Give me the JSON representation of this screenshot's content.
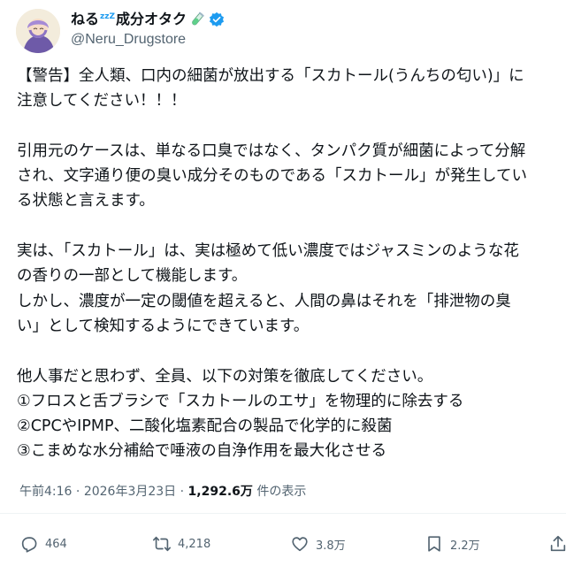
{
  "author": {
    "display_name_pre": "ねる",
    "display_name_zzz": "zzZ",
    "display_name_post": "成分オタク",
    "handle": "@Neru_Drugstore",
    "accent_color": "#1d9bf0"
  },
  "tweet": {
    "lines": [
      "【警告】全人類、口内の細菌が放出する「スカトール(うんちの匂い)」に",
      "注意してください！！！",
      "",
      "引用元のケースは、単なる口臭ではなく、タンパク質が細菌によって分解",
      "され、文字通り便の臭い成分そのものである「スカトール」が発生してい",
      "る状態と言えます。",
      "",
      "実は、「スカトール」は、実は極めて低い濃度ではジャスミンのような花",
      "の香りの一部として機能します。",
      "しかし、濃度が一定の閾値を超えると、人間の鼻はそれを「排泄物の臭",
      "い」として検知するようにできています。",
      "",
      "他人事だと思わず、全員、以下の対策を徹底してください。",
      "①フロスと舌ブラシで「スカトールのエサ」を物理的に除去する",
      "②CPCやIPMP、二酸化塩素配合の製品で化学的に殺菌",
      "③こまめな水分補給で唾液の自浄作用を最大化させる"
    ]
  },
  "meta": {
    "time": "午前4:16",
    "separator": "·",
    "date": "2026年3月23日",
    "views_count": "1,292.6万",
    "views_label": "件の表示"
  },
  "actions": {
    "replies": "464",
    "reposts": "4,218",
    "likes": "3.8万",
    "bookmarks": "2.2万"
  }
}
